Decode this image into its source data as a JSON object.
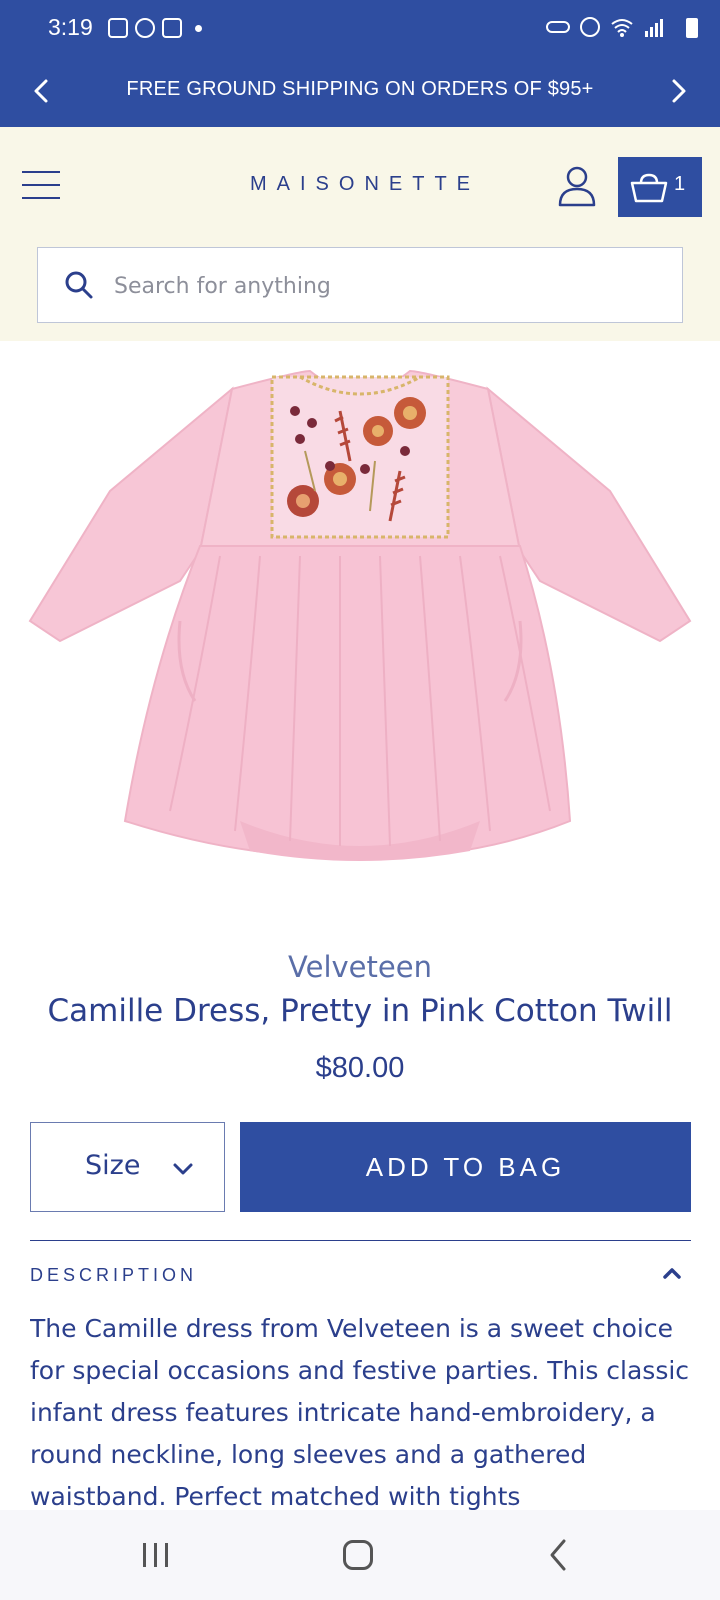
{
  "status_bar": {
    "time": "3:19",
    "icons": [
      "gallery-icon",
      "whatsapp-icon",
      "outlook-icon",
      "dot-icon",
      "key-icon",
      "alarm-icon",
      "wifi-icon",
      "signal-icon",
      "battery-icon"
    ]
  },
  "promo": {
    "text": "FREE GROUND SHIPPING ON ORDERS OF $95+"
  },
  "header": {
    "brand": "MAISONETTE",
    "bag_count": "1",
    "search_placeholder": "Search for anything"
  },
  "product": {
    "brand": "Velveteen",
    "title": "Camille Dress, Pretty in Pink Cotton Twill",
    "price": "$80.00",
    "size_label": "Size",
    "add_to_bag_label": "ADD TO BAG",
    "description_heading": "DESCRIPTION",
    "description": "The Camille dress from Velveteen is a sweet choice for special occasions and festive parties. This classic infant dress features intricate hand-embroidery, a round neckline, long sleeves and a gathered waistband. Perfect matched with tights"
  },
  "colors": {
    "brand_blue": "#2f4ea1",
    "header_bg": "#f9f7e8",
    "text_blue": "#2b3f8c",
    "dress_pink": "#f7c6d6"
  }
}
